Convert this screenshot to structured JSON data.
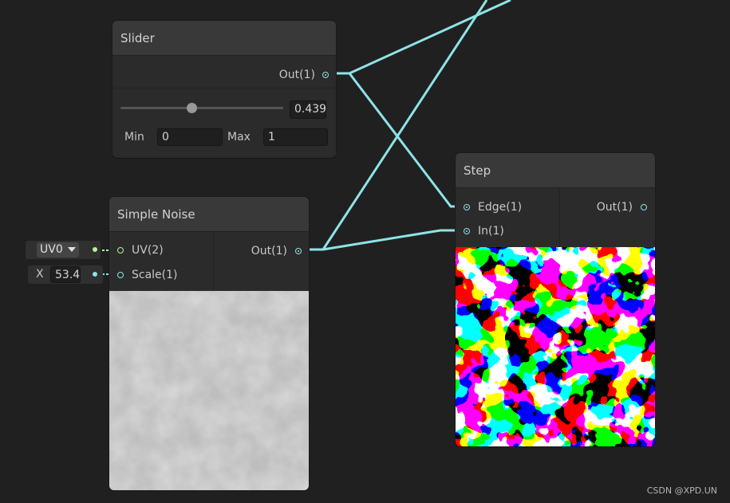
{
  "nodes": {
    "slider": {
      "title": "Slider",
      "output_label": "Out(1)",
      "value_text": "0.439",
      "slider_fraction": 0.44,
      "min_label": "Min",
      "min_value": "0",
      "max_label": "Max",
      "max_value": "1"
    },
    "simple_noise": {
      "title": "Simple Noise",
      "inputs": [
        {
          "label": "UV(2)"
        },
        {
          "label": "Scale(1)"
        }
      ],
      "output_label": "Out(1)",
      "uv_channel": "UV0",
      "scale_axis": "X",
      "scale_value": "53.4"
    },
    "step": {
      "title": "Step",
      "inputs": [
        {
          "label": "Edge(1)"
        },
        {
          "label": "In(1)"
        }
      ],
      "output_label": "Out(1)"
    }
  },
  "colors": {
    "wire": "#8ee3e6",
    "uv_port": "#b5f29b",
    "background": "#202020"
  },
  "watermark": "CSDN @XPD.UN"
}
